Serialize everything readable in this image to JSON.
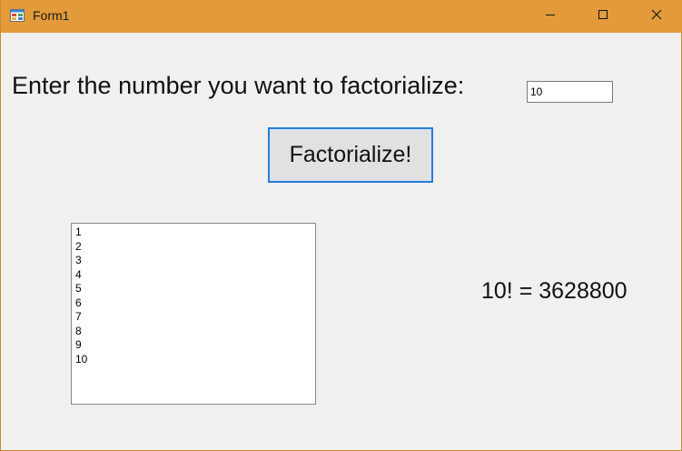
{
  "window": {
    "title": "Form1",
    "app_icon": "form-app-icon",
    "controls": {
      "minimize_icon": "minimize-icon",
      "maximize_icon": "maximize-icon",
      "close_icon": "close-icon"
    },
    "titlebar_color": "#e29a3a"
  },
  "form": {
    "prompt_label": "Enter the number you want to factorialize:",
    "input_value": "10",
    "button_label": "Factorialize!",
    "list_items": [
      "1",
      "2",
      "3",
      "4",
      "5",
      "6",
      "7",
      "8",
      "9",
      "10"
    ],
    "result_text": "10! = 3628800",
    "accent_color": "#2a7bd6"
  }
}
